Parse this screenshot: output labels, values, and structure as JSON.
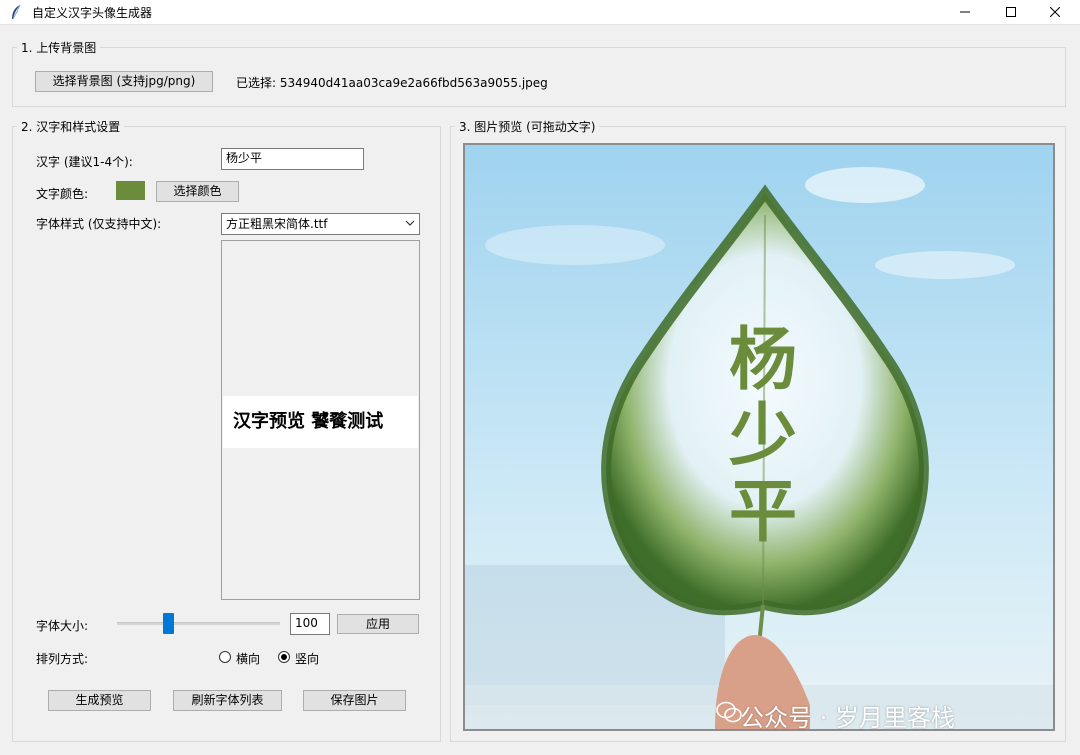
{
  "window": {
    "title": "自定义汉字头像生成器",
    "icons": [
      "feather-icon",
      "minimize-icon",
      "maximize-icon",
      "close-icon"
    ]
  },
  "upload_section": {
    "label": "1. 上传背景图",
    "select_button": "选择背景图 (支持jpg/png)",
    "selected_text": "已选择: 534940d41aa03ca9e2a66fbd563a9055.jpeg"
  },
  "settings_section": {
    "label": "2. 汉字和样式设置",
    "chars_label": "汉字 (建议1-4个):",
    "chars_value": "杨少平",
    "color_label": "文字颜色:",
    "color_swatch": "#6b8c3a",
    "color_button": "选择颜色",
    "font_label": "字体样式 (仅支持中文):",
    "font_value": "方正粗黑宋简体.ttf",
    "font_preview_text": "汉字预览 饕餮测试",
    "size_label": "字体大小:",
    "size_value": "100",
    "size_slider_fraction": 0.3,
    "apply_button": "应用",
    "layout_label": "排列方式:",
    "layout_horizontal": "横向",
    "layout_vertical": "竖向",
    "layout_selected": "竖向",
    "generate_button": "生成预览",
    "refresh_button": "刷新字体列表",
    "save_button": "保存图片"
  },
  "preview_section": {
    "label": "3. 图片预览 (可拖动文字)",
    "overlay_chars": [
      "杨",
      "少",
      "平"
    ],
    "text_color": "#6b8c3a"
  },
  "watermark": {
    "text": "公众号 · 岁月里客栈",
    "icon": "wechat-icon"
  }
}
